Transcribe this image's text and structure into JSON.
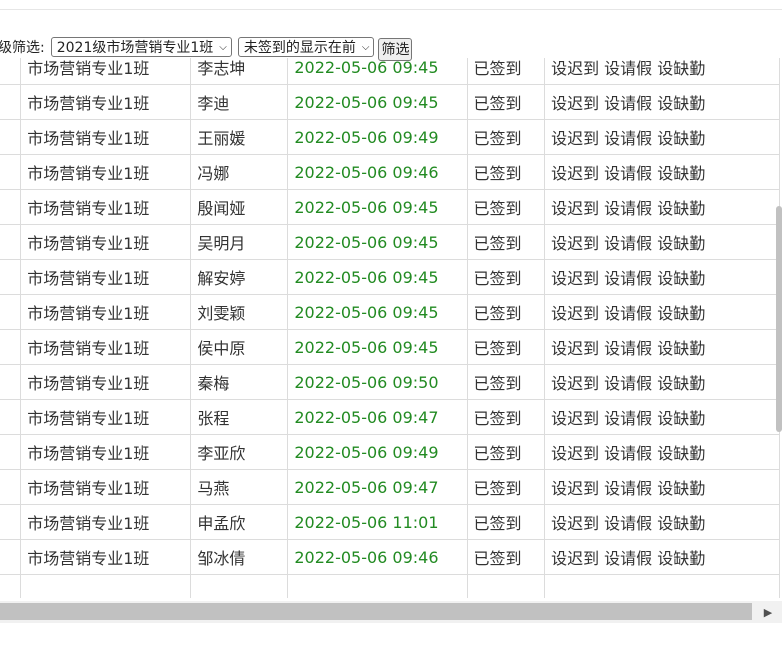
{
  "filter": {
    "label": "级筛选:",
    "class_select": "2021级市场营销专业1班",
    "order_select": "未签到的显示在前",
    "button": "筛选"
  },
  "table": {
    "rows": [
      {
        "cls": "市场营销专业1班",
        "name": "李志坤",
        "time": "2022-05-06 09:45",
        "status": "已签到"
      },
      {
        "cls": "市场营销专业1班",
        "name": "李迪",
        "time": "2022-05-06 09:45",
        "status": "已签到"
      },
      {
        "cls": "市场营销专业1班",
        "name": "王丽媛",
        "time": "2022-05-06 09:49",
        "status": "已签到"
      },
      {
        "cls": "市场营销专业1班",
        "name": "冯娜",
        "time": "2022-05-06 09:46",
        "status": "已签到"
      },
      {
        "cls": "市场营销专业1班",
        "name": "殷闻娅",
        "time": "2022-05-06 09:45",
        "status": "已签到"
      },
      {
        "cls": "市场营销专业1班",
        "name": "吴明月",
        "time": "2022-05-06 09:45",
        "status": "已签到"
      },
      {
        "cls": "市场营销专业1班",
        "name": "解安婷",
        "time": "2022-05-06 09:45",
        "status": "已签到"
      },
      {
        "cls": "市场营销专业1班",
        "name": "刘雯颖",
        "time": "2022-05-06 09:45",
        "status": "已签到"
      },
      {
        "cls": "市场营销专业1班",
        "name": "侯中原",
        "time": "2022-05-06 09:45",
        "status": "已签到"
      },
      {
        "cls": "市场营销专业1班",
        "name": "秦梅",
        "time": "2022-05-06 09:50",
        "status": "已签到"
      },
      {
        "cls": "市场营销专业1班",
        "name": "张程",
        "time": "2022-05-06 09:47",
        "status": "已签到"
      },
      {
        "cls": "市场营销专业1班",
        "name": "李亚欣",
        "time": "2022-05-06 09:49",
        "status": "已签到"
      },
      {
        "cls": "市场营销专业1班",
        "name": "马燕",
        "time": "2022-05-06 09:47",
        "status": "已签到"
      },
      {
        "cls": "市场营销专业1班",
        "name": "申孟欣",
        "time": "2022-05-06 11:01",
        "status": "已签到"
      },
      {
        "cls": "市场营销专业1班",
        "name": "邹冰倩",
        "time": "2022-05-06 09:46",
        "status": "已签到"
      }
    ],
    "actions": {
      "late": "设迟到",
      "leave": "设请假",
      "absent": "设缺勤"
    }
  },
  "colors": {
    "time_text": "#228b22",
    "border": "#dcdcdc",
    "scroll_thumb": "#c1c1c1"
  },
  "icons": {
    "select_arrow": "chevron-down-icon",
    "scroll_right": "triangle-right-icon"
  }
}
